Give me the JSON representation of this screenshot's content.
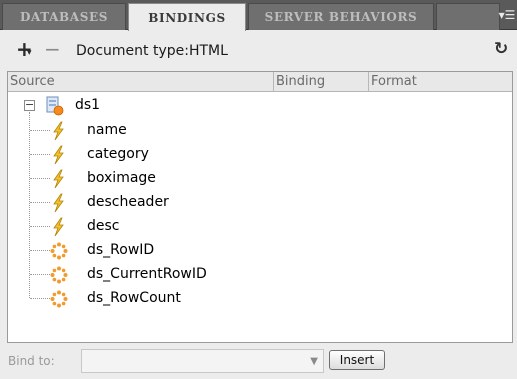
{
  "tabs": [
    {
      "label": "DATABASES",
      "active": false
    },
    {
      "label": "BINDINGS",
      "active": true
    },
    {
      "label": "SERVER BEHAVIORS",
      "active": false
    }
  ],
  "toolbar": {
    "add_icon": "plus-icon",
    "remove_icon": "minus-icon",
    "doctype_label": "Document type:HTML",
    "refresh_icon": "refresh-icon",
    "menu_icon": "panel-menu-icon"
  },
  "columns": [
    "Source",
    "Binding",
    "Format"
  ],
  "tree": {
    "root": {
      "label": "ds1",
      "expanded": true,
      "icon": "dataset-icon"
    },
    "children": [
      {
        "label": "name",
        "icon": "lightning-bolt-icon"
      },
      {
        "label": "category",
        "icon": "lightning-bolt-icon"
      },
      {
        "label": "boximage",
        "icon": "lightning-bolt-icon"
      },
      {
        "label": "descheader",
        "icon": "lightning-bolt-icon"
      },
      {
        "label": "desc",
        "icon": "lightning-bolt-icon"
      },
      {
        "label": "ds_RowID",
        "icon": "gear-icon"
      },
      {
        "label": "ds_CurrentRowID",
        "icon": "gear-icon"
      },
      {
        "label": "ds_RowCount",
        "icon": "gear-icon"
      }
    ]
  },
  "bottom": {
    "bind_to_label": "Bind to:",
    "bind_to_value": "",
    "insert_label": "Insert"
  },
  "colors": {
    "tab_bar": "#5a5a5a",
    "active_tab": "#ececec",
    "bolt": "#e0b020",
    "gear": "#f39a2e"
  }
}
